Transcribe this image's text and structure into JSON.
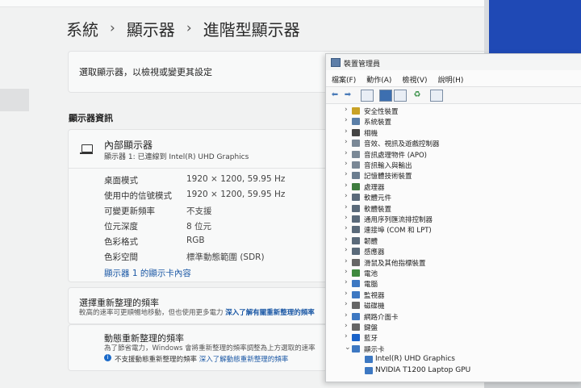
{
  "settings": {
    "breadcrumb": [
      "系統",
      "顯示器",
      "進階型顯示器"
    ],
    "breadcrumb_sep": "›",
    "select_display_label": "選取顯示器，以檢視或變更其設定",
    "display_info_title": "顯示器資訊",
    "internal_display": {
      "title": "內部顯示器",
      "subtitle": "顯示器 1: 已連線到 Intel(R) UHD Graphics",
      "icon": "monitor-icon"
    },
    "info_rows": [
      {
        "label": "桌面模式",
        "value": "1920 × 1200, 59.95 Hz"
      },
      {
        "label": "使用中的信號模式",
        "value": "1920 × 1200, 59.95 Hz"
      },
      {
        "label": "可變更新頻率",
        "value": "不支援"
      },
      {
        "label": "位元深度",
        "value": "8 位元"
      },
      {
        "label": "色彩格式",
        "value": "RGB"
      },
      {
        "label": "色彩空間",
        "value": "標準動態範圍 (SDR)"
      }
    ],
    "adapter_link": "顯示器 1 的顯示卡內容",
    "refresh_rate": {
      "title": "選擇重新整理的頻率",
      "subtitle": "較高的速率可更順暢地移動，但也使用更多電力",
      "link": "深入了解有關重新整理的頻率"
    },
    "dynamic_refresh": {
      "title": "動態重新整理的頻率",
      "subtitle": "為了節省電力，Windows 會將重新整理的頻率調整為上方選取的速率",
      "note": "不支援動態重新整理的頻率",
      "note_link": "深入了解動態重新整理的頻率",
      "info_icon": "info-icon"
    }
  },
  "device_manager": {
    "title": "裝置管理員",
    "menus": [
      "檔案(F)",
      "動作(A)",
      "檢視(V)",
      "說明(H)"
    ],
    "categories": [
      {
        "label": "安全性裝置",
        "color": "#c9a227"
      },
      {
        "label": "系統裝置",
        "color": "#5b7fa8"
      },
      {
        "label": "相機",
        "color": "#444444"
      },
      {
        "label": "音效、視訊及遊戲控制器",
        "color": "#7a8896"
      },
      {
        "label": "音訊處理物件 (APO)",
        "color": "#7a8896"
      },
      {
        "label": "音訊輸入與輸出",
        "color": "#7a8896"
      },
      {
        "label": "記憶體技術裝置",
        "color": "#6b7d8f"
      },
      {
        "label": "處理器",
        "color": "#3f7d3f"
      },
      {
        "label": "軟體元件",
        "color": "#5a6a7a"
      },
      {
        "label": "軟體裝置",
        "color": "#5a6a7a"
      },
      {
        "label": "通用序列匯流排控制器",
        "color": "#5a6a7a"
      },
      {
        "label": "連接埠 (COM 和 LPT)",
        "color": "#5a6a7a"
      },
      {
        "label": "韌體",
        "color": "#5a6a7a"
      },
      {
        "label": "感應器",
        "color": "#5a6a7a"
      },
      {
        "label": "滑鼠及其他指標裝置",
        "color": "#666666"
      },
      {
        "label": "電池",
        "color": "#3f8a3f"
      },
      {
        "label": "電腦",
        "color": "#3d78c2"
      },
      {
        "label": "監視器",
        "color": "#3d78c2"
      },
      {
        "label": "磁碟機",
        "color": "#666666"
      },
      {
        "label": "網路介面卡",
        "color": "#3d78c2"
      },
      {
        "label": "鍵盤",
        "color": "#666666"
      },
      {
        "label": "藍牙",
        "color": "#1a63c9"
      },
      {
        "label": "顯示卡",
        "color": "#3d78c2",
        "expanded": true
      }
    ],
    "display_adapters": [
      "Intel(R) UHD Graphics",
      "NVIDIA T1200 Laptop GPU"
    ],
    "chevron_collapsed": "›",
    "chevron_expanded": "⌄"
  }
}
